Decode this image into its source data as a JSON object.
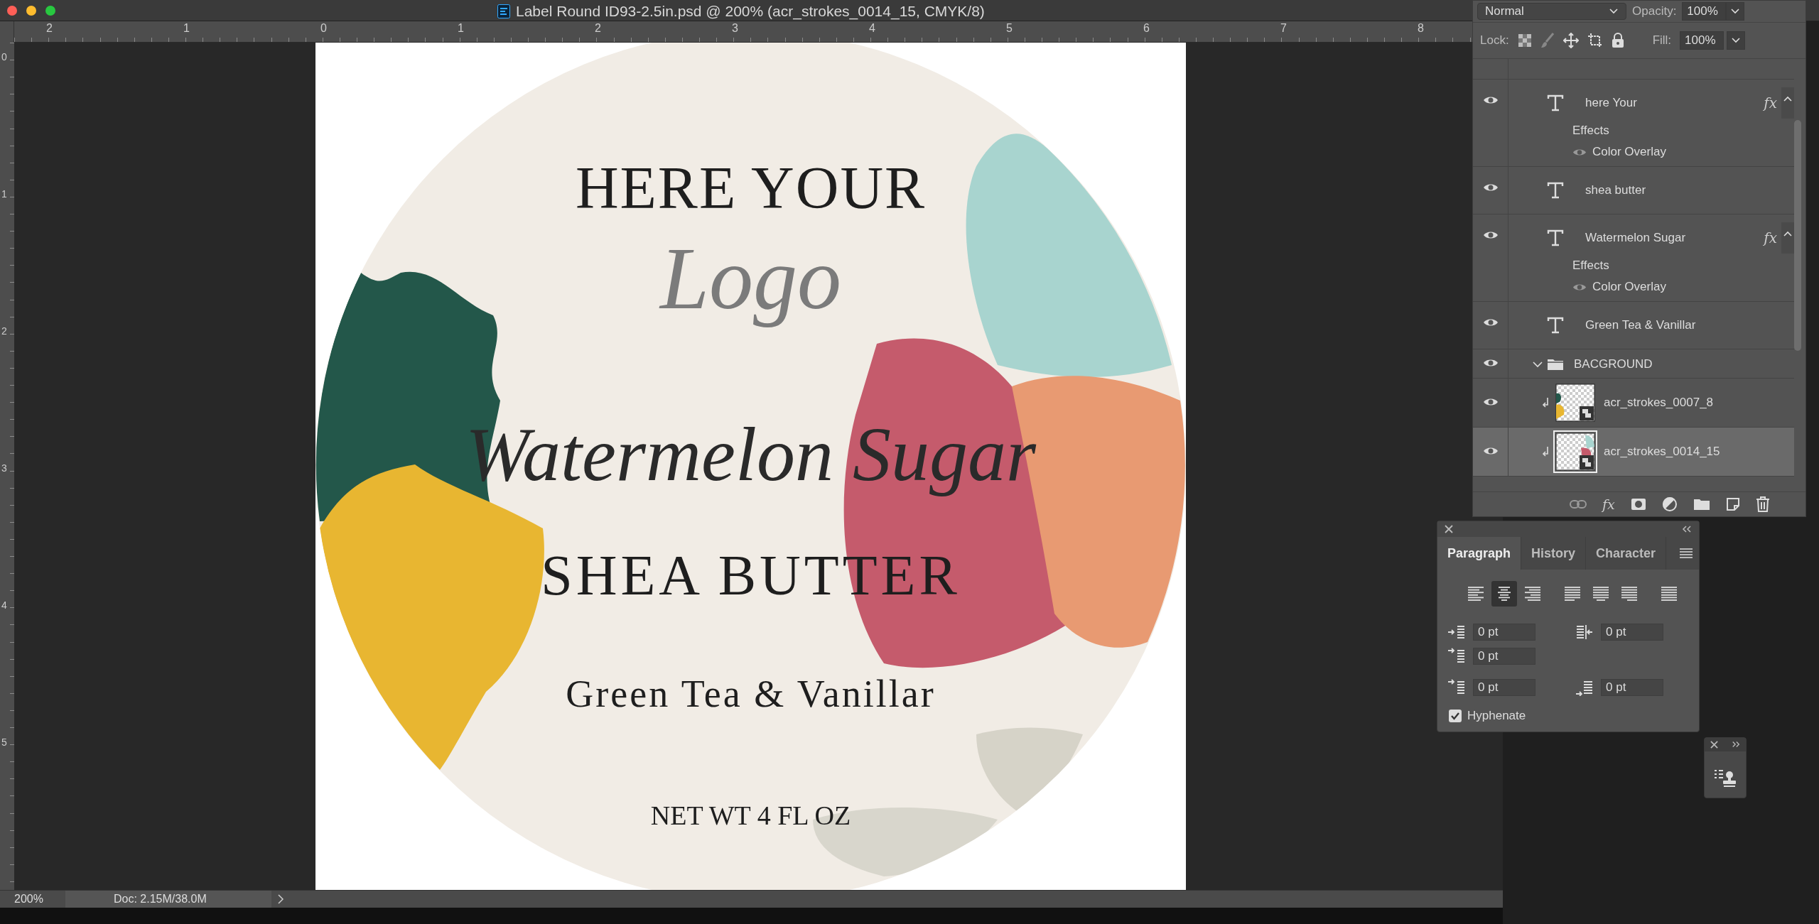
{
  "window": {
    "title": "Label Round ID93-2.5in.psd @ 200% (acr_strokes_0014_15, CMYK/8)"
  },
  "ruler": {
    "top_labels": [
      "2",
      "1",
      "0",
      "1",
      "2",
      "3",
      "4",
      "5",
      "6",
      "7",
      "8"
    ],
    "left_labels": [
      "0",
      "1",
      "2",
      "3",
      "4",
      "5"
    ]
  },
  "document": {
    "lines": [
      {
        "kind": "serif-caps",
        "text": "HERE YOUR"
      },
      {
        "kind": "script-gray",
        "text": "Logo"
      },
      {
        "kind": "script",
        "text": "Watermelon Sugar"
      },
      {
        "kind": "serif-spaced",
        "text": "SHEA BUTTER"
      },
      {
        "kind": "serif-medium",
        "text": "Green Tea & Vanillar"
      },
      {
        "kind": "serif-small",
        "text": "NET WT 4 FL OZ"
      }
    ]
  },
  "layers_panel": {
    "blend_mode": "Normal",
    "opacity_label": "Opacity:",
    "opacity": "100%",
    "lock_label": "Lock:",
    "fill_label": "Fill:",
    "fill": "100%",
    "layers": [
      {
        "kind": "text",
        "name": "here Your",
        "visible": true,
        "selected": false,
        "fx": "fx",
        "effects_label": "Effects",
        "effects": [
          {
            "name": "Color Overlay",
            "visible": true
          }
        ]
      },
      {
        "kind": "text",
        "name": "shea butter",
        "visible": true,
        "selected": false
      },
      {
        "kind": "text",
        "name": "Watermelon Sugar",
        "visible": true,
        "selected": false,
        "fx": "fx",
        "effects_label": "Effects",
        "effects": [
          {
            "name": "Color Overlay",
            "visible": true
          }
        ]
      },
      {
        "kind": "text",
        "name": "Green Tea & Vanillar",
        "visible": true,
        "selected": false
      },
      {
        "kind": "group",
        "name": "BACGROUND",
        "visible": true,
        "selected": false,
        "expanded": true
      },
      {
        "kind": "smart",
        "name": "acr_strokes_0007_8",
        "visible": true,
        "selected": false
      },
      {
        "kind": "smart",
        "name": "acr_strokes_0014_15",
        "visible": true,
        "selected": true
      }
    ],
    "toolbar_fx": "fx"
  },
  "paragraph_panel": {
    "tabs": [
      {
        "label": "Paragraph",
        "selected": true
      },
      {
        "label": "History",
        "selected": false
      },
      {
        "label": "Character",
        "selected": false
      }
    ],
    "alignments": [
      {
        "kind": "left",
        "selected": false
      },
      {
        "kind": "center",
        "selected": true
      },
      {
        "kind": "right",
        "selected": false
      },
      {
        "kind": "justify-left",
        "selected": false
      },
      {
        "kind": "justify-center",
        "selected": false
      },
      {
        "kind": "justify-right",
        "selected": false
      },
      {
        "kind": "justify-all",
        "selected": false
      }
    ],
    "fields": [
      {
        "kind": "indent-left",
        "value": "0 pt"
      },
      {
        "kind": "indent-right",
        "value": "0 pt"
      },
      {
        "kind": "first-line",
        "value": "0 pt"
      },
      {
        "kind": "space-before",
        "value": "0 pt"
      },
      {
        "kind": "space-after",
        "value": "0 pt"
      }
    ],
    "hyphenate": {
      "label": "Hyphenate",
      "checked": true
    }
  },
  "status_bar": {
    "zoom": "200%",
    "doc_info": "Doc: 2.15M/38.0M"
  }
}
